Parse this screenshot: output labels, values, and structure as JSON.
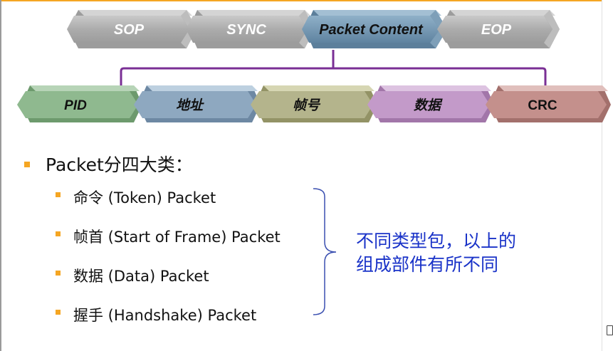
{
  "packet_structure": {
    "fields": [
      "SOP",
      "SYNC",
      "Packet  Content",
      "EOP"
    ],
    "active_field": "Packet  Content",
    "content_fields": [
      "PID",
      "地址",
      "帧号",
      "数据",
      "CRC"
    ],
    "colors": {
      "inactive": "#a9a9a9",
      "active": "#6f92ae",
      "connector": "#7a2f95",
      "pid": "#8fb98f",
      "address": "#8ea8c0",
      "frame": "#b4b48c",
      "data": "#c39ac9",
      "crc": "#c4908c"
    }
  },
  "main_bullet": "Packet分四大类：",
  "packet_types": [
    "命令 (Token) Packet",
    "帧首 (Start of Frame) Packet",
    "数据 (Data) Packet",
    "握手 (Handshake) Packet"
  ],
  "note": {
    "line1": "不同类型包，以上的",
    "line2": "组成部件有所不同",
    "color": "#1a33c8"
  }
}
